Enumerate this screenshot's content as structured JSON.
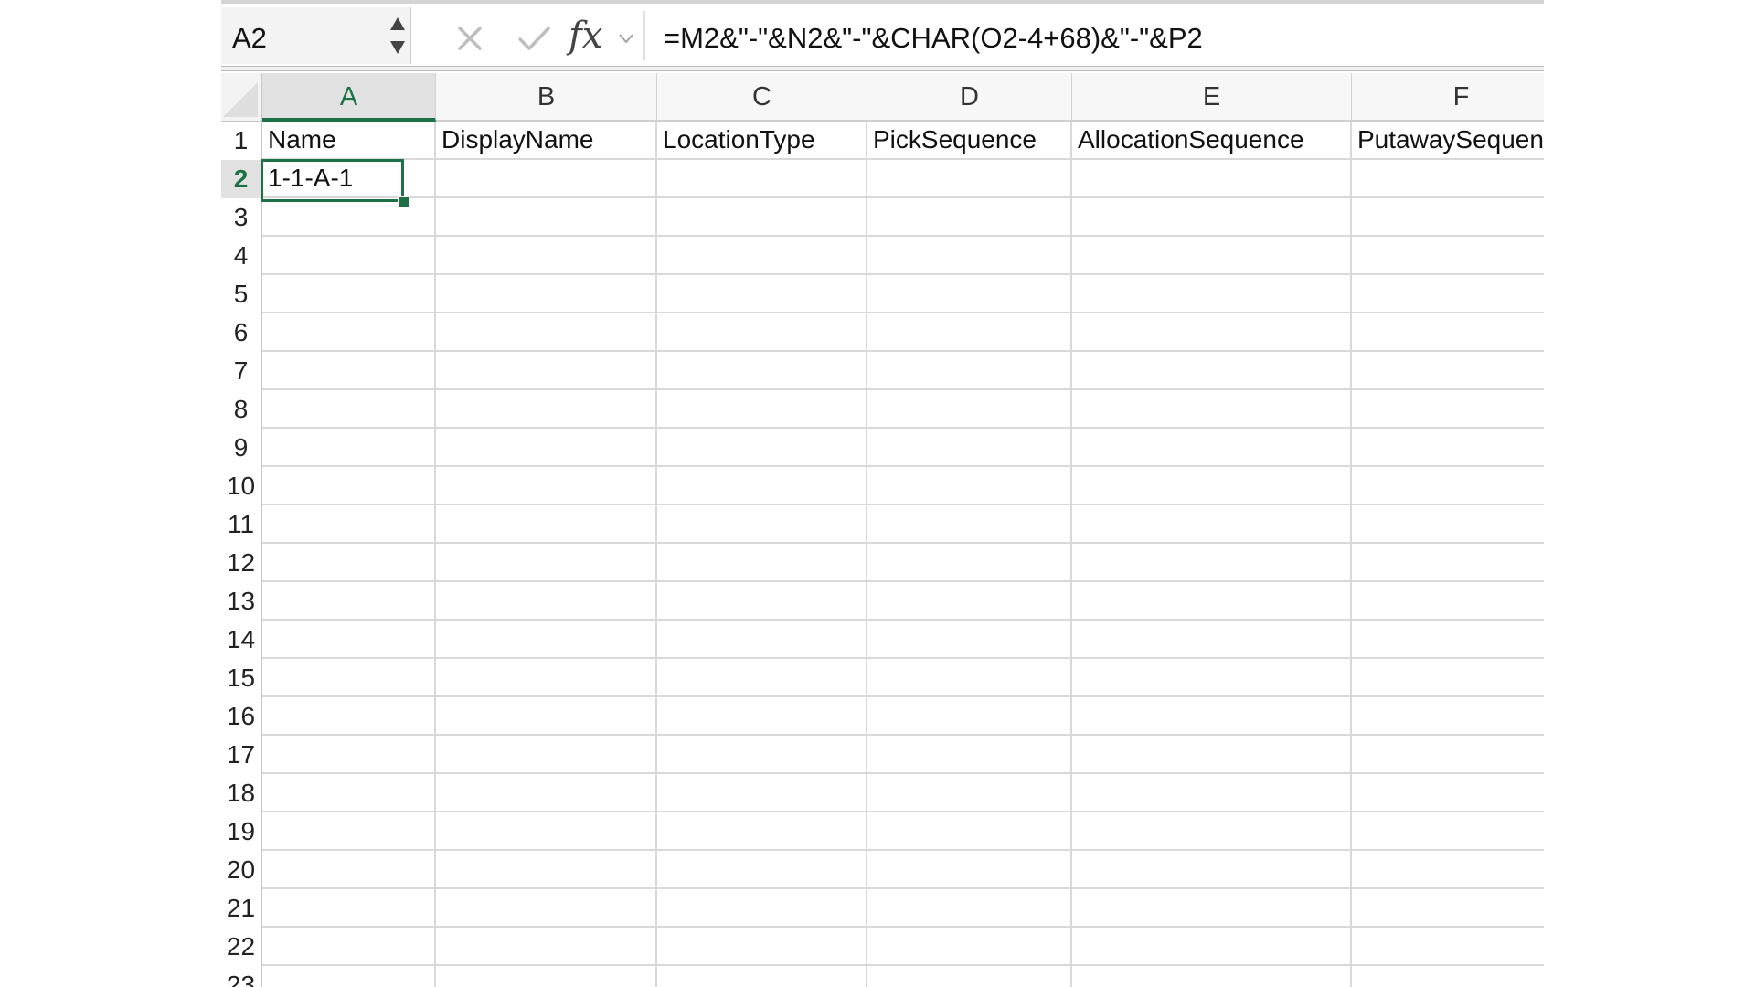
{
  "formula_bar": {
    "name_box": "A2",
    "formula": "=M2&\"-\"&N2&\"-\"&CHAR(O2-4+68)&\"-\"&P2",
    "fx_label": "fx"
  },
  "icons": {
    "cancel": "close-icon",
    "confirm": "checkmark-icon",
    "function": "fx-icon",
    "expand": "chevron-down-icon"
  },
  "sheet": {
    "columns": [
      "A",
      "B",
      "C",
      "D",
      "E",
      "F"
    ],
    "rows": [
      "1",
      "2",
      "3",
      "4",
      "5",
      "6",
      "7",
      "8",
      "9",
      "10",
      "11",
      "12",
      "13",
      "14",
      "15",
      "16",
      "17",
      "18",
      "19",
      "20",
      "21",
      "22",
      "23"
    ],
    "headers_row": [
      "Name",
      "DisplayName",
      "LocationType",
      "PickSequence",
      "AllocationSequence",
      "PutawaySequence"
    ],
    "row2": [
      "1-1-A-1",
      "",
      "",
      "",
      "",
      ""
    ],
    "active_cell": "A2",
    "active_column": "A",
    "active_row": "2"
  },
  "colors": {
    "accent": "#1e7145",
    "gridline": "#d9d9d9",
    "header_bg": "#f7f7f7"
  }
}
